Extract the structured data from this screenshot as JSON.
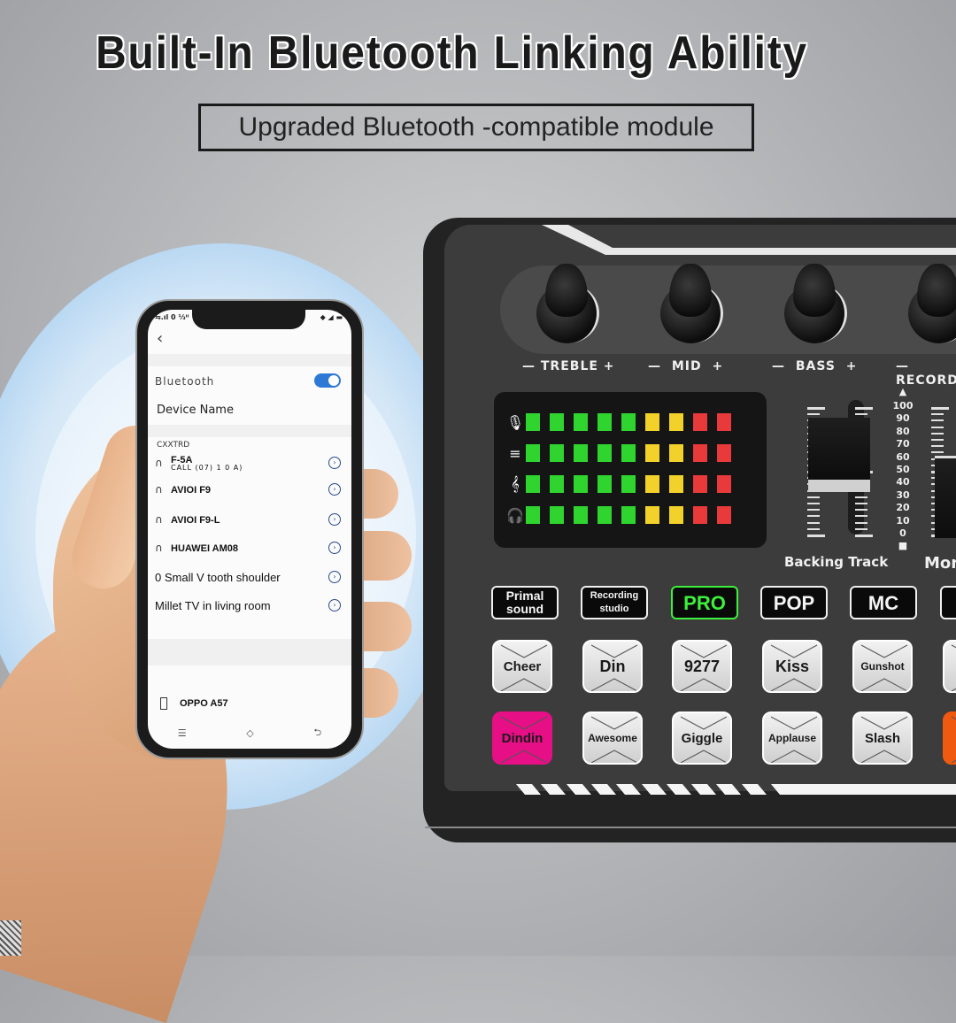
{
  "headline": "Built-In Bluetooth Linking Ability",
  "subheadline": "Upgraded Bluetooth -compatible module",
  "phone": {
    "status_left": "⇆.ıl 0 ⅓ᴵᴵ",
    "status_right": "◆ ◢ ▬",
    "back_icon": "‹",
    "bluetooth_label": "Bluetooth",
    "bluetooth_enabled": true,
    "device_name_label": "Device Name",
    "section_label": "CXXTRD",
    "devices": [
      {
        "icon": "headphones-icon",
        "name": "F-5A",
        "subtitle": "CALL (07) 1 0 A)"
      },
      {
        "icon": "headphones-icon",
        "name": "AVIOI F9",
        "subtitle": ""
      },
      {
        "icon": "headphones-icon",
        "name": "AVIOI F9-L",
        "subtitle": ""
      },
      {
        "icon": "headphones-icon",
        "name": "HUAWEI AM08",
        "subtitle": ""
      },
      {
        "icon": "",
        "name": "0 Small V tooth shoulder",
        "subtitle": ""
      },
      {
        "icon": "",
        "name": "Millet TV in living room",
        "subtitle": ""
      }
    ],
    "this_device": "OPPO A57",
    "nav": [
      "☰",
      "◇",
      "⮌"
    ]
  },
  "mixer": {
    "knobs": [
      {
        "label": "— TREBLE +"
      },
      {
        "label": "— MID +"
      },
      {
        "label": "— BASS +"
      },
      {
        "label": "—RECORD"
      }
    ],
    "meter": {
      "rows": [
        {
          "icon": "microphone-icon",
          "glyph": "🎙"
        },
        {
          "icon": "music-icon",
          "glyph": "≡"
        },
        {
          "icon": "treble-clef-icon",
          "glyph": "𝄞"
        },
        {
          "icon": "headphones-icon",
          "glyph": "🎧"
        }
      ],
      "leds_per_row": 9,
      "colors": [
        "#2fd42f",
        "#2fd42f",
        "#2fd42f",
        "#2fd42f",
        "#2fd42f",
        "#f2d22a",
        "#f2d22a",
        "#e83a3a",
        "#e83a3a"
      ]
    },
    "fader": {
      "label": "Backing Track",
      "scale": [
        "100",
        "90",
        "80",
        "70",
        "60",
        "50",
        "40",
        "30",
        "20",
        "10",
        "0"
      ],
      "level_percent": 50,
      "top_marker": "▲",
      "bottom_marker": "■"
    },
    "fader2_label": "Mon",
    "modes": [
      {
        "label": "Primal\nsound",
        "active": false
      },
      {
        "label": "Recording\nstudio",
        "active": false
      },
      {
        "label": "PRO",
        "active": true
      },
      {
        "label": "POP",
        "active": false
      },
      {
        "label": "MC",
        "active": false
      },
      {
        "label": "",
        "active": false
      }
    ],
    "pads_row1": [
      "Cheer",
      "Din",
      "9277",
      "Kiss",
      "Gunshot",
      ""
    ],
    "pads_row2": [
      "Dindin",
      "Awesome",
      "Giggle",
      "Applause",
      "Slash",
      ""
    ],
    "accent_colors": {
      "pro_green": "#3cf03c",
      "dindin_pink": "#e60f86",
      "orange": "#f05a10",
      "toggle_blue": "#2f79d6"
    }
  }
}
